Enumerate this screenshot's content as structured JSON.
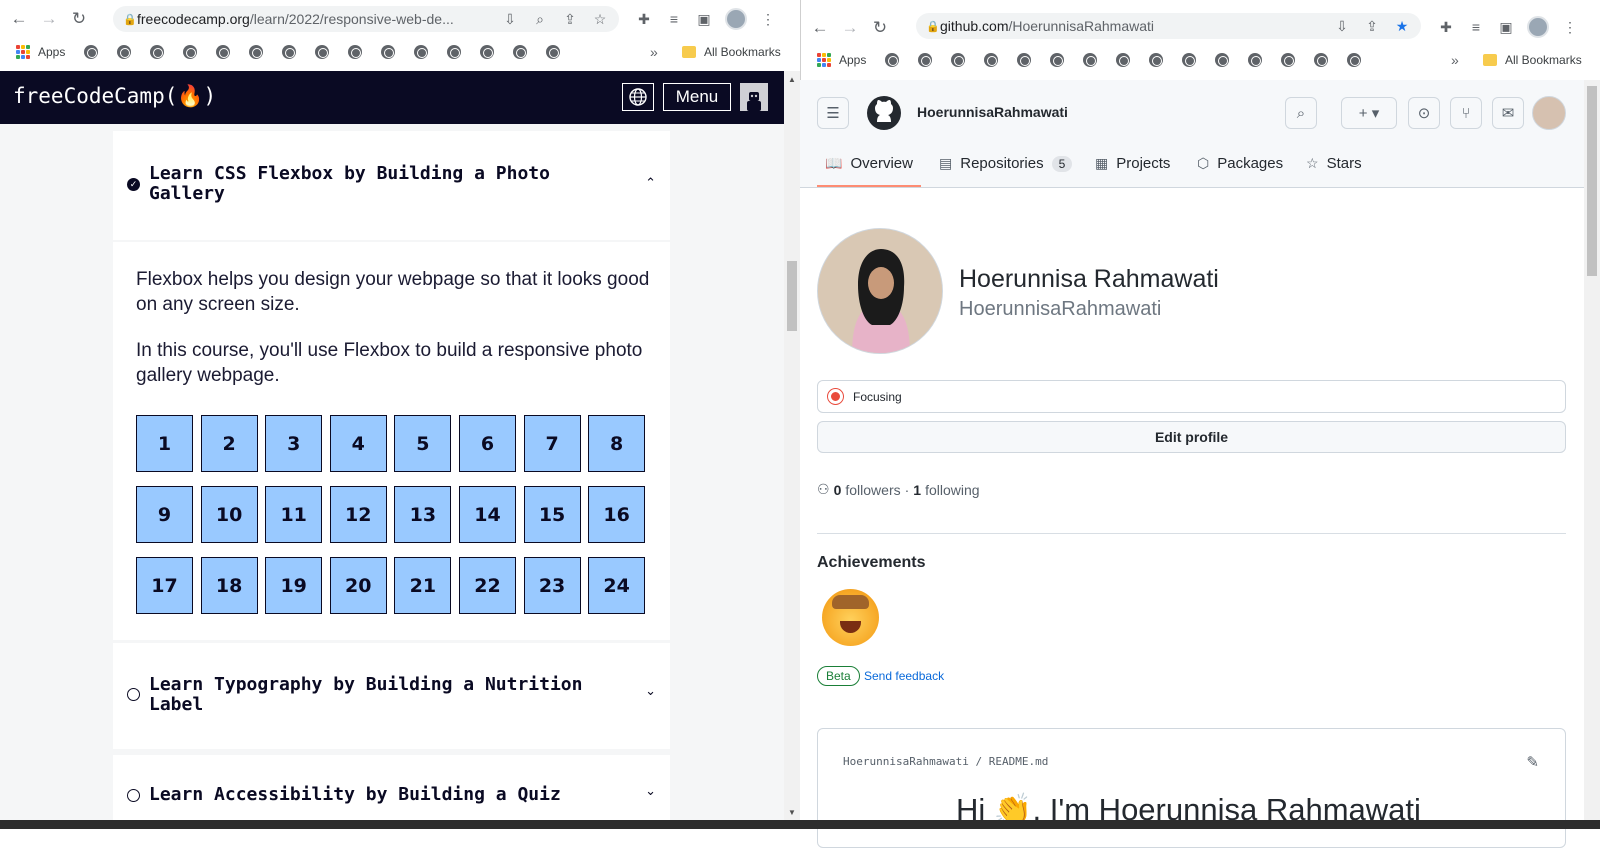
{
  "left_browser": {
    "url_host": "freecodecamp.org",
    "url_path": "/learn/2022/responsive-web-de...",
    "bookmarks_apps": "Apps",
    "bookmarks_more": "»",
    "bookmarks_all": "All Bookmarks"
  },
  "right_browser": {
    "url_host": "github.com",
    "url_path": "/HoerunnisaRahmawati",
    "bookmarks_apps": "Apps",
    "bookmarks_more": "»",
    "bookmarks_all": "All Bookmarks"
  },
  "fcc": {
    "logo": "freeCodeCamp(🔥)",
    "menu_label": "Menu",
    "blocks": [
      {
        "title": "Learn CSS Flexbox by Building a Photo Gallery",
        "completed": true,
        "expanded": true
      },
      {
        "title": "Learn Typography by Building a Nutrition Label",
        "completed": false,
        "expanded": false
      },
      {
        "title": "Learn Accessibility by Building a Quiz",
        "completed": false,
        "expanded": false
      }
    ],
    "description": [
      "Flexbox helps you design your webpage so that it looks good on any screen size.",
      "In this course, you'll use Flexbox to build a responsive photo gallery webpage."
    ],
    "tiles": [
      "1",
      "2",
      "3",
      "4",
      "5",
      "6",
      "7",
      "8",
      "9",
      "10",
      "11",
      "12",
      "13",
      "14",
      "15",
      "16",
      "17",
      "18",
      "19",
      "20",
      "21",
      "22",
      "23",
      "24"
    ],
    "colors": {
      "nav": "#0a0a23",
      "tile": "#99c9ff",
      "page": "#f5f6f7"
    }
  },
  "github": {
    "header_user": "HoerunnisaRahmawati",
    "tabs": [
      {
        "label": "Overview",
        "icon": "book-icon",
        "counter": ""
      },
      {
        "label": "Repositories",
        "icon": "repo-icon",
        "counter": "5"
      },
      {
        "label": "Projects",
        "icon": "table-icon",
        "counter": ""
      },
      {
        "label": "Packages",
        "icon": "package-icon",
        "counter": ""
      },
      {
        "label": "Stars",
        "icon": "star-icon",
        "counter": ""
      }
    ],
    "name": "Hoerunnisa Rahmawati",
    "login": "HoerunnisaRahmawati",
    "status": "Focusing",
    "edit_profile": "Edit profile",
    "followers_count": "0",
    "followers_label": "followers",
    "sep": "·",
    "following_count": "1",
    "following_label": "following",
    "achievements_title": "Achievements",
    "beta_label": "Beta",
    "feedback_label": "Send feedback",
    "readme_owner": "HoerunnisaRahmawati",
    "readme_slash": "/",
    "readme_file": "README.md",
    "readme_heading": "Hi 👏, I'm Hoerunnisa Rahmawati",
    "colors": {
      "underline": "#fd8c73",
      "link": "#0969da",
      "beta": "#1a7f37"
    }
  }
}
